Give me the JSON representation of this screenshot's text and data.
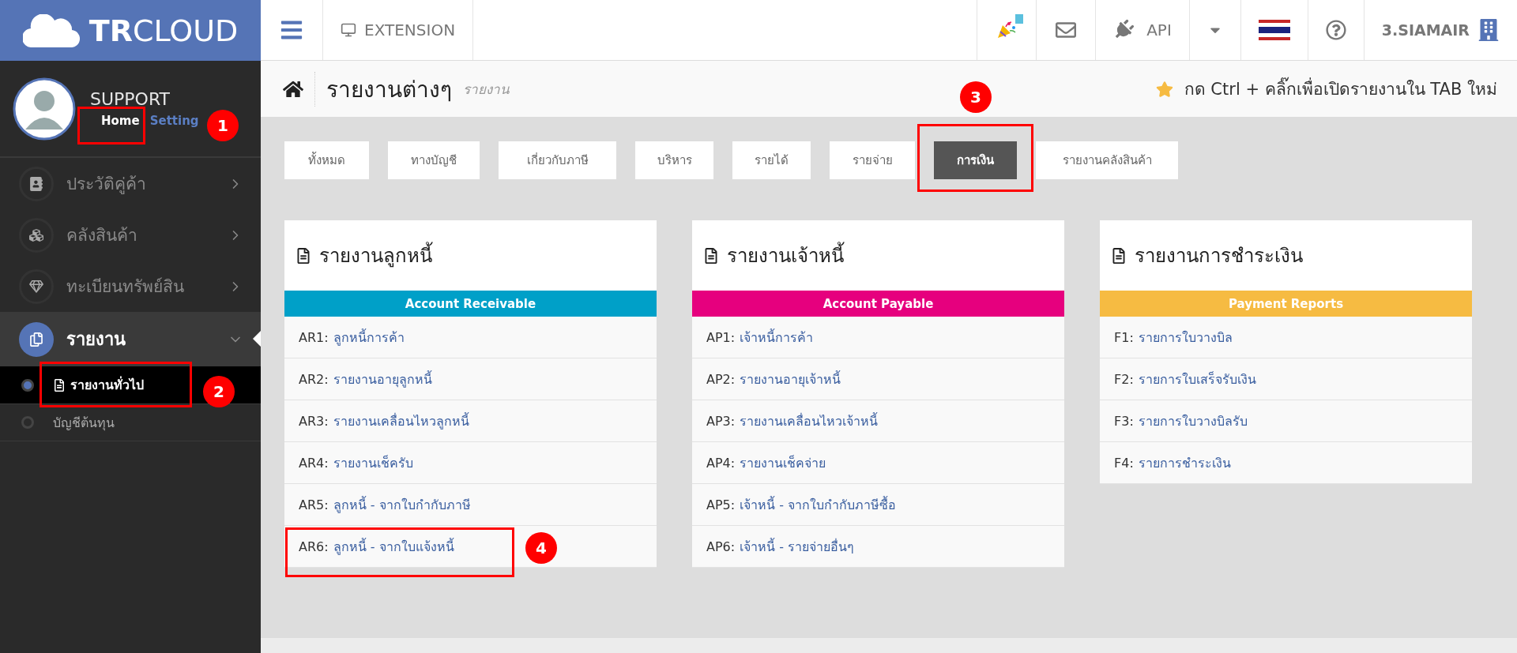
{
  "brand": {
    "logo": "**TR**CLOUD"
  },
  "topbar": {
    "extension": "EXTENSION",
    "api": "API",
    "company": "3.SIAMAIR"
  },
  "user": {
    "name": "SUPPORT",
    "links": [
      {
        "label": "Home",
        "selected": true
      },
      {
        "label": "Setting",
        "selected": false
      }
    ]
  },
  "sidebar": {
    "items": [
      {
        "label": "ประวัติคู่ค้า",
        "expanded": false,
        "selected": false
      },
      {
        "label": "คลังสินค้า",
        "expanded": false,
        "selected": false
      },
      {
        "label": "ทะเบียนทรัพย์สิน",
        "expanded": false,
        "selected": false
      },
      {
        "label": "รายงาน",
        "expanded": true,
        "selected": true,
        "children": [
          {
            "label": "รายงานทั่วไป",
            "selected": true
          },
          {
            "label": "บัญชีต้นทุน",
            "selected": false
          }
        ]
      }
    ]
  },
  "page": {
    "title": "รายงานต่างๆ",
    "subtitle": "รายงาน",
    "hint": "กด Ctrl + คลิ๊กเพื่อเปิดรายงานใน TAB ใหม่"
  },
  "tabs": [
    {
      "label": "ทั้งหมด",
      "selected": false
    },
    {
      "label": "ทางบัญชี",
      "selected": false
    },
    {
      "label": "เกี่ยวกับภาษี",
      "selected": false
    },
    {
      "label": "บริหาร",
      "selected": false
    },
    {
      "label": "รายได้",
      "selected": false
    },
    {
      "label": "รายจ่าย",
      "selected": false
    },
    {
      "label": "การเงิน",
      "selected": true
    },
    {
      "label": "รายงานคลังสินค้า",
      "selected": false
    }
  ],
  "cards": [
    {
      "title": "รายงานลูกหนี้",
      "band": "Account Receivable",
      "color": "#00a0c8",
      "rows": [
        {
          "code": "AR1:",
          "label": "ลูกหนี้การค้า"
        },
        {
          "code": "AR2:",
          "label": "รายงานอายุลูกหนี้"
        },
        {
          "code": "AR3:",
          "label": "รายงานเคลื่อนไหวลูกหนี้"
        },
        {
          "code": "AR4:",
          "label": "รายงานเช็ครับ"
        },
        {
          "code": "AR5:",
          "label": "ลูกหนี้ - จากใบกำกับภาษี"
        },
        {
          "code": "AR6:",
          "label": "ลูกหนี้ - จากใบแจ้งหนี้"
        }
      ]
    },
    {
      "title": "รายงานเจ้าหนี้",
      "band": "Account Payable",
      "color": "#e6007e",
      "rows": [
        {
          "code": "AP1:",
          "label": "เจ้าหนี้การค้า"
        },
        {
          "code": "AP2:",
          "label": "รายงานอายุเจ้าหนี้"
        },
        {
          "code": "AP3:",
          "label": "รายงานเคลื่อนไหวเจ้าหนี้"
        },
        {
          "code": "AP4:",
          "label": "รายงานเช็คจ่าย"
        },
        {
          "code": "AP5:",
          "label": "เจ้าหนี้ - จากใบกำกับภาษีซื้อ"
        },
        {
          "code": "AP6:",
          "label": "เจ้าหนี้ - รายจ่ายอื่นๆ"
        }
      ]
    },
    {
      "title": "รายงานการชำระเงิน",
      "band": "Payment Reports",
      "color": "#f6bb42",
      "rows": [
        {
          "code": "F1:",
          "label": "รายการใบวางบิล"
        },
        {
          "code": "F2:",
          "label": "รายการใบเสร็จรับเงิน"
        },
        {
          "code": "F3:",
          "label": "รายการใบวางบิลรับ"
        },
        {
          "code": "F4:",
          "label": "รายการชำระเงิน"
        }
      ]
    }
  ],
  "annotations": [
    {
      "number": "1"
    },
    {
      "number": "2"
    },
    {
      "number": "3"
    },
    {
      "number": "4"
    }
  ]
}
